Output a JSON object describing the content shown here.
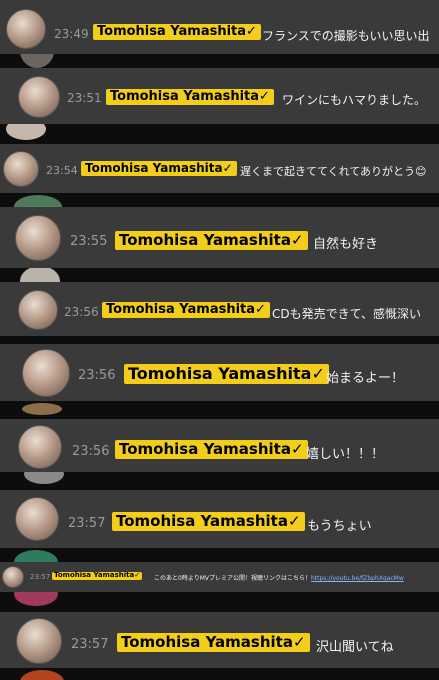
{
  "messages": [
    {
      "time": "23:49",
      "author": "Tomohisa Yamashita✓",
      "text": "フランスでの撮影もいい思い出"
    },
    {
      "time": "23:51",
      "author": "Tomohisa Yamashita✓",
      "text": "ワインにもハマりました。"
    },
    {
      "time": "23:54",
      "author": "Tomohisa Yamashita✓",
      "text": "遅くまで起きててくれてありがとう😊"
    },
    {
      "time": "23:55",
      "author": "Tomohisa Yamashita✓",
      "text": "自然も好き"
    },
    {
      "time": "23:56",
      "author": "Tomohisa Yamashita✓",
      "text": "CDも発売できて、感慨深い"
    },
    {
      "time": "23:56",
      "author": "Tomohisa Yamashita✓",
      "text": "始まるよー！"
    },
    {
      "time": "23:56",
      "author": "Tomohisa Yamashita✓",
      "text": "嬉しい！！！"
    },
    {
      "time": "23:57",
      "author": "Tomohisa Yamashita✓",
      "text": "もうちょい"
    },
    {
      "time": "23:57",
      "author": "Tomohisa Yamashita✓",
      "text": "このあと0時よりMVプレミア公開！視聴リンクはこちら！",
      "link": "https://youtu.be/fZbphXqacMw"
    },
    {
      "time": "23:57",
      "author": "Tomohisa Yamashita✓",
      "text": "沢山聞いてね"
    }
  ],
  "colors": {
    "background": "#3a3a3a",
    "badge": "#f2ce1b",
    "time": "#9a9a9a",
    "text": "#f2f2f2"
  }
}
